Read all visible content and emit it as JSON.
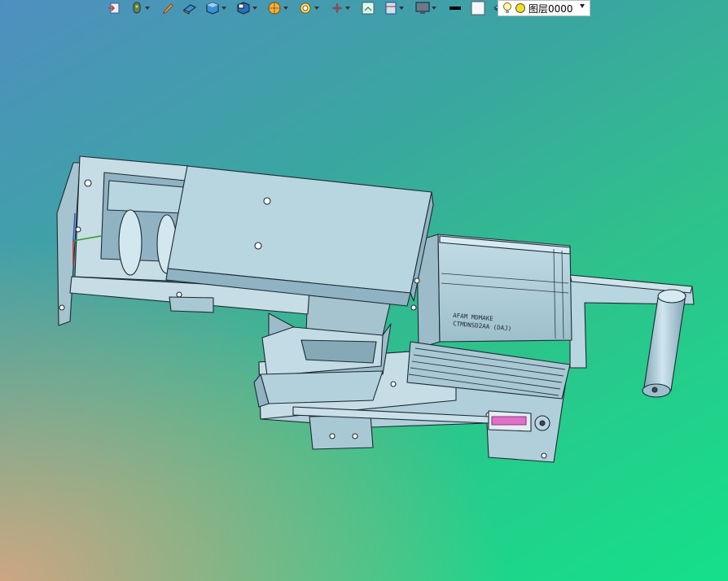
{
  "window": {
    "type": "3d-cad-viewport"
  },
  "toolbar": {
    "items": [
      {
        "icon": "import-icon",
        "dropdown": false
      },
      {
        "icon": "mouse-navigation-icon",
        "dropdown": true
      },
      {
        "icon": "pen-edit-icon",
        "dropdown": false
      },
      {
        "icon": "eraser-icon",
        "dropdown": false
      },
      {
        "icon": "cube-solid-icon",
        "dropdown": true
      },
      {
        "icon": "cube-view-icon",
        "dropdown": true
      },
      {
        "icon": "render-sphere-icon",
        "dropdown": true
      },
      {
        "icon": "zoom-fit-icon",
        "dropdown": true
      },
      {
        "icon": "axis-triad-icon",
        "dropdown": true
      },
      {
        "icon": "section-view-icon",
        "dropdown": false
      },
      {
        "icon": "clip-plane-icon",
        "dropdown": true
      },
      {
        "icon": "display-monitor-icon",
        "dropdown": true
      },
      {
        "icon": "line-color-icon",
        "dropdown": false
      },
      {
        "icon": "fill-color-icon",
        "dropdown": false
      },
      {
        "icon": "layer-stack-icon",
        "dropdown": true
      }
    ],
    "layer_selector": {
      "icons": [
        "lightbulb-icon",
        "layer-color-icon"
      ],
      "value": "图层0000"
    }
  },
  "motor_label": {
    "line1": "AFAM MDMAKE",
    "line2": "CTMDNSD2AA (DAJ)"
  },
  "colors": {
    "part_fill": "#b8d6e0",
    "part_fill_dark": "#8fb3c2",
    "edge": "#1d2a33",
    "accent_pink": "#e070c8"
  }
}
